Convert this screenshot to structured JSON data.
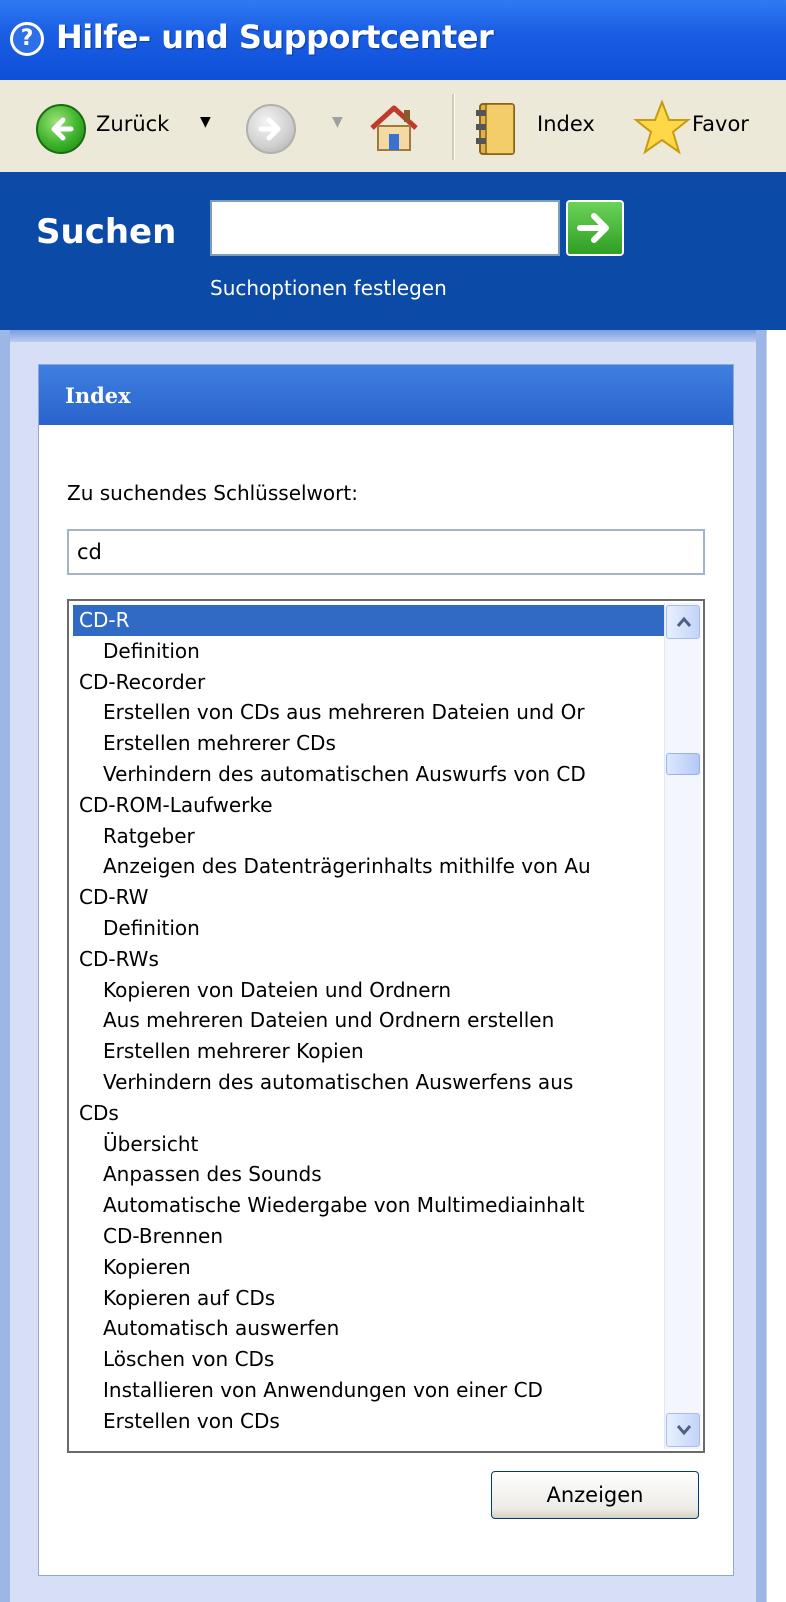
{
  "window": {
    "title": "Hilfe- und Supportcenter"
  },
  "toolbar": {
    "back_label": "Zurück",
    "index_label": "Index",
    "favorites_label": "Favor"
  },
  "search": {
    "label": "Suchen",
    "value": "",
    "options_link": "Suchoptionen festlegen"
  },
  "index_panel": {
    "title": "Index",
    "keyword_label": "Zu suchendes Schlüsselwort:",
    "keyword_value": "cd",
    "items": [
      {
        "text": "CD-R",
        "level": 0,
        "selected": true
      },
      {
        "text": "Definition",
        "level": 1
      },
      {
        "text": "CD-Recorder",
        "level": 0
      },
      {
        "text": "Erstellen von CDs aus mehreren Dateien und Or",
        "level": 1
      },
      {
        "text": "Erstellen mehrerer CDs",
        "level": 1
      },
      {
        "text": "Verhindern des automatischen Auswurfs von CD",
        "level": 1
      },
      {
        "text": "CD-ROM-Laufwerke",
        "level": 0
      },
      {
        "text": "Ratgeber",
        "level": 1
      },
      {
        "text": "Anzeigen des Datenträgerinhalts mithilfe von Au",
        "level": 1
      },
      {
        "text": "CD-RW",
        "level": 0
      },
      {
        "text": "Definition",
        "level": 1
      },
      {
        "text": "CD-RWs",
        "level": 0
      },
      {
        "text": "Kopieren von Dateien und Ordnern",
        "level": 1
      },
      {
        "text": "Aus mehreren Dateien und Ordnern erstellen",
        "level": 1
      },
      {
        "text": "Erstellen mehrerer Kopien",
        "level": 1
      },
      {
        "text": "Verhindern des automatischen Auswerfens aus",
        "level": 1
      },
      {
        "text": "CDs",
        "level": 0
      },
      {
        "text": "Übersicht",
        "level": 1
      },
      {
        "text": "Anpassen des Sounds",
        "level": 1
      },
      {
        "text": "Automatische Wiedergabe von Multimediainhalt",
        "level": 1
      },
      {
        "text": "CD-Brennen",
        "level": 1
      },
      {
        "text": "Kopieren",
        "level": 1
      },
      {
        "text": "Kopieren auf CDs",
        "level": 1
      },
      {
        "text": "Automatisch auswerfen",
        "level": 1
      },
      {
        "text": "Löschen von CDs",
        "level": 1
      },
      {
        "text": "Installieren von Anwendungen von einer CD",
        "level": 1
      },
      {
        "text": "Erstellen von CDs",
        "level": 1
      }
    ],
    "show_button": "Anzeigen"
  },
  "icons": {
    "help": "help-circle-icon",
    "back": "back-arrow-icon",
    "forward": "forward-arrow-icon",
    "home": "home-icon",
    "index": "index-book-icon",
    "favorites": "star-icon",
    "search_go": "go-arrow-icon"
  },
  "colors": {
    "title_bar": "#1a5ee4",
    "search_band": "#0c4aa8",
    "panel_header": "#2a63cc",
    "selection": "#316ac5"
  }
}
